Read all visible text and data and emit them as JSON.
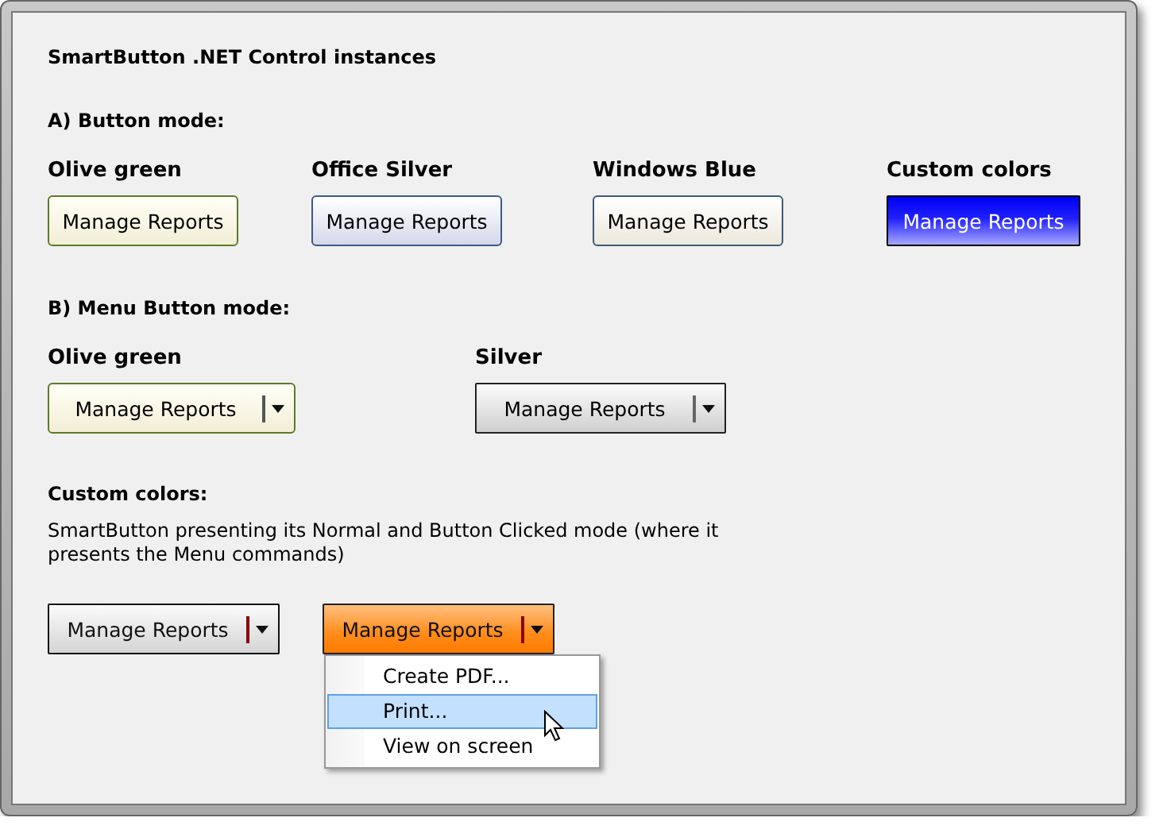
{
  "panel": {
    "title": "SmartButton .NET Control instances"
  },
  "button_mode": {
    "heading": "A) Button mode:",
    "buttons": [
      {
        "label": "Olive green",
        "text": "Manage Reports",
        "kind": "olive"
      },
      {
        "label": "Office Silver",
        "text": "Manage Reports",
        "kind": "office"
      },
      {
        "label": "Windows Blue",
        "text": "Manage Reports",
        "kind": "winblue"
      },
      {
        "label": "Custom colors",
        "text": "Manage Reports",
        "kind": "blue"
      }
    ]
  },
  "menu_button_mode": {
    "heading": "B) Menu Button mode:",
    "buttons": [
      {
        "label": "Olive green",
        "text": "Manage Reports",
        "kind": "olive"
      },
      {
        "label": "Silver",
        "text": "Manage Reports",
        "kind": "silver"
      }
    ]
  },
  "custom_colors": {
    "heading": "Custom colors:",
    "description": "SmartButton presenting its Normal and Button Clicked mode (where it presents the Menu commands)",
    "buttons": [
      {
        "text": "Manage Reports",
        "kind": "plain"
      },
      {
        "text": "Manage Reports",
        "kind": "orange",
        "menu": [
          {
            "label": "Create PDF...",
            "selected": false
          },
          {
            "label": "Print...",
            "selected": true
          },
          {
            "label": "View on screen",
            "selected": false
          }
        ]
      }
    ]
  }
}
